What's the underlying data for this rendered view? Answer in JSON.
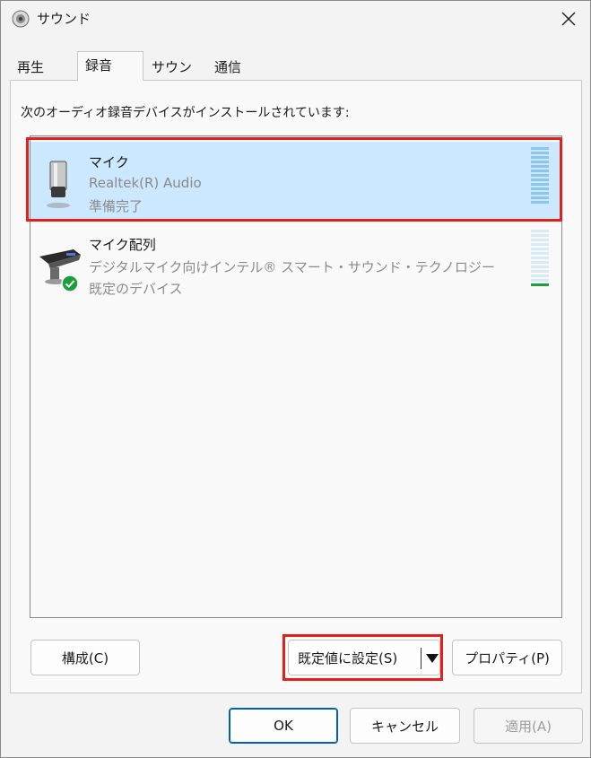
{
  "window": {
    "title": "サウンド",
    "close_label": "×"
  },
  "tabs": [
    {
      "label": "再生",
      "active": false
    },
    {
      "label": "録音",
      "active": true
    },
    {
      "label": "サウンド",
      "active": false
    },
    {
      "label": "通信",
      "active": false
    }
  ],
  "description": "次のオーディオ録音デバイスがインストールされています:",
  "devices": [
    {
      "name": "マイク",
      "driver": "Realtek(R) Audio",
      "status": "準備完了",
      "selected": true,
      "icon": "microphone-icon"
    },
    {
      "name": "マイク配列",
      "driver": "デジタルマイク向けインテル® スマート・サウンド・テクノロジー",
      "status": "既定のデバイス",
      "selected": false,
      "icon": "mic-array-icon",
      "default_badge": "check-circle-icon"
    }
  ],
  "buttons": {
    "configure": "構成(C)",
    "set_default": "既定値に設定(S)",
    "properties": "プロパティ(P)",
    "ok": "OK",
    "cancel": "キャンセル",
    "apply": "適用(A)"
  },
  "colors": {
    "selection": "#cce8ff",
    "highlight": "#e0201a",
    "accent": "#005fb8",
    "meter_green": "#1d9e3b"
  }
}
